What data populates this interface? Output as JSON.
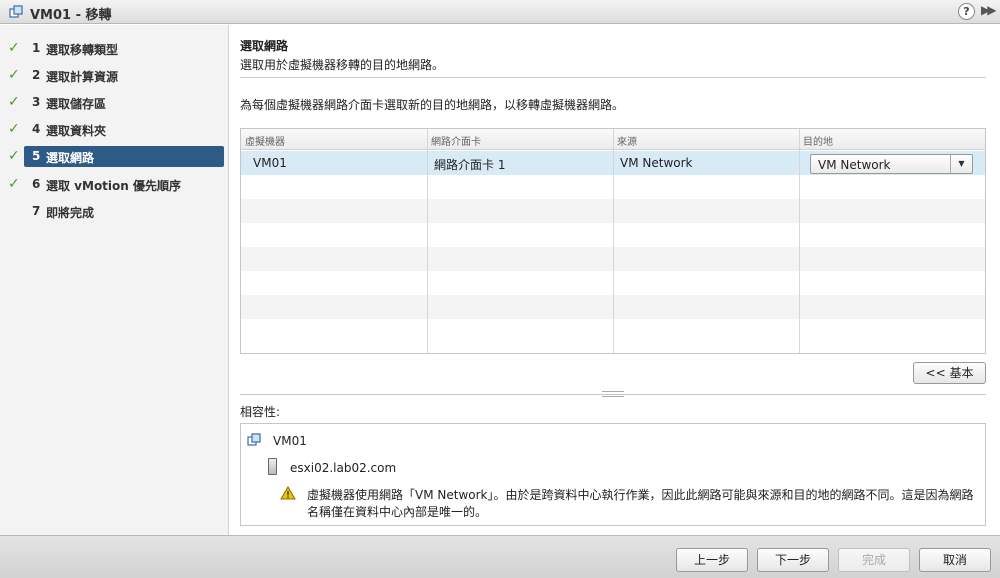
{
  "window": {
    "title": "VM01 - 移轉",
    "help_label": "?",
    "expand_label": "▶▶"
  },
  "sidebar": {
    "steps": [
      {
        "num": "1",
        "label": "選取移轉類型",
        "done": true
      },
      {
        "num": "2",
        "label": "選取計算資源",
        "done": true
      },
      {
        "num": "3",
        "label": "選取儲存區",
        "done": true
      },
      {
        "num": "4",
        "label": "選取資料夾",
        "done": true
      },
      {
        "num": "5",
        "label": "選取網路",
        "done": true,
        "active": true
      },
      {
        "num": "6",
        "label": "選取 vMotion 優先順序",
        "done": true
      },
      {
        "num": "7",
        "label": "即將完成",
        "done": false
      }
    ]
  },
  "main": {
    "title": "選取網路",
    "description": "選取用於虛擬機器移轉的目的地網路。",
    "instruction": "為每個虛擬機器網路介面卡選取新的目的地網路，以移轉虛擬機器網路。",
    "table": {
      "columns": [
        "虛擬機器",
        "網路介面卡",
        "來源",
        "目的地"
      ],
      "rows": [
        {
          "vm": "VM01",
          "nic": "網路介面卡 1",
          "source": "VM Network",
          "destination": "VM Network"
        }
      ]
    },
    "basic_button": "<< 基本",
    "compat_label": "相容性:",
    "compat": {
      "vm": "VM01",
      "host": "esxi02.lab02.com",
      "warning": "虛擬機器使用網路「VM Network」。由於是跨資料中心執行作業，因此此網路可能與來源和目的地的網路不同。這是因為網路名稱僅在資料中心內部是唯一的。"
    }
  },
  "footer": {
    "back": "上一步",
    "next": "下一步",
    "finish": "完成",
    "cancel": "取消"
  },
  "colors": {
    "active_step": "#2d5a86",
    "check": "#4a9a2a",
    "selected_row": "#d9eaf7",
    "warning": "#f2c200"
  }
}
